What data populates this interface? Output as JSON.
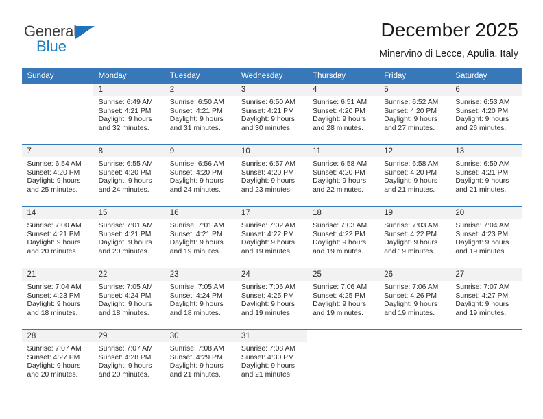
{
  "brand": {
    "name_top": "General",
    "name_bottom": "Blue",
    "triangle_icon": "blue-triangle-logo-mark",
    "color": "#1a7fc1"
  },
  "header": {
    "title": "December 2025",
    "subtitle": "Minervino di Lecce, Apulia, Italy"
  },
  "theme": {
    "header_bg": "#3878b8",
    "header_text": "#ffffff",
    "daynum_bg": "#f2f2f2",
    "grid_line": "#3878b8"
  },
  "calendar": {
    "weekday_headers": [
      "Sunday",
      "Monday",
      "Tuesday",
      "Wednesday",
      "Thursday",
      "Friday",
      "Saturday"
    ],
    "weeks": [
      [
        {
          "day": "",
          "info": ""
        },
        {
          "day": "1",
          "info": "Sunrise: 6:49 AM\nSunset: 4:21 PM\nDaylight: 9 hours\nand 32 minutes."
        },
        {
          "day": "2",
          "info": "Sunrise: 6:50 AM\nSunset: 4:21 PM\nDaylight: 9 hours\nand 31 minutes."
        },
        {
          "day": "3",
          "info": "Sunrise: 6:50 AM\nSunset: 4:21 PM\nDaylight: 9 hours\nand 30 minutes."
        },
        {
          "day": "4",
          "info": "Sunrise: 6:51 AM\nSunset: 4:20 PM\nDaylight: 9 hours\nand 28 minutes."
        },
        {
          "day": "5",
          "info": "Sunrise: 6:52 AM\nSunset: 4:20 PM\nDaylight: 9 hours\nand 27 minutes."
        },
        {
          "day": "6",
          "info": "Sunrise: 6:53 AM\nSunset: 4:20 PM\nDaylight: 9 hours\nand 26 minutes."
        }
      ],
      [
        {
          "day": "7",
          "info": "Sunrise: 6:54 AM\nSunset: 4:20 PM\nDaylight: 9 hours\nand 25 minutes."
        },
        {
          "day": "8",
          "info": "Sunrise: 6:55 AM\nSunset: 4:20 PM\nDaylight: 9 hours\nand 24 minutes."
        },
        {
          "day": "9",
          "info": "Sunrise: 6:56 AM\nSunset: 4:20 PM\nDaylight: 9 hours\nand 24 minutes."
        },
        {
          "day": "10",
          "info": "Sunrise: 6:57 AM\nSunset: 4:20 PM\nDaylight: 9 hours\nand 23 minutes."
        },
        {
          "day": "11",
          "info": "Sunrise: 6:58 AM\nSunset: 4:20 PM\nDaylight: 9 hours\nand 22 minutes."
        },
        {
          "day": "12",
          "info": "Sunrise: 6:58 AM\nSunset: 4:20 PM\nDaylight: 9 hours\nand 21 minutes."
        },
        {
          "day": "13",
          "info": "Sunrise: 6:59 AM\nSunset: 4:21 PM\nDaylight: 9 hours\nand 21 minutes."
        }
      ],
      [
        {
          "day": "14",
          "info": "Sunrise: 7:00 AM\nSunset: 4:21 PM\nDaylight: 9 hours\nand 20 minutes."
        },
        {
          "day": "15",
          "info": "Sunrise: 7:01 AM\nSunset: 4:21 PM\nDaylight: 9 hours\nand 20 minutes."
        },
        {
          "day": "16",
          "info": "Sunrise: 7:01 AM\nSunset: 4:21 PM\nDaylight: 9 hours\nand 19 minutes."
        },
        {
          "day": "17",
          "info": "Sunrise: 7:02 AM\nSunset: 4:22 PM\nDaylight: 9 hours\nand 19 minutes."
        },
        {
          "day": "18",
          "info": "Sunrise: 7:03 AM\nSunset: 4:22 PM\nDaylight: 9 hours\nand 19 minutes."
        },
        {
          "day": "19",
          "info": "Sunrise: 7:03 AM\nSunset: 4:22 PM\nDaylight: 9 hours\nand 19 minutes."
        },
        {
          "day": "20",
          "info": "Sunrise: 7:04 AM\nSunset: 4:23 PM\nDaylight: 9 hours\nand 19 minutes."
        }
      ],
      [
        {
          "day": "21",
          "info": "Sunrise: 7:04 AM\nSunset: 4:23 PM\nDaylight: 9 hours\nand 18 minutes."
        },
        {
          "day": "22",
          "info": "Sunrise: 7:05 AM\nSunset: 4:24 PM\nDaylight: 9 hours\nand 18 minutes."
        },
        {
          "day": "23",
          "info": "Sunrise: 7:05 AM\nSunset: 4:24 PM\nDaylight: 9 hours\nand 18 minutes."
        },
        {
          "day": "24",
          "info": "Sunrise: 7:06 AM\nSunset: 4:25 PM\nDaylight: 9 hours\nand 19 minutes."
        },
        {
          "day": "25",
          "info": "Sunrise: 7:06 AM\nSunset: 4:25 PM\nDaylight: 9 hours\nand 19 minutes."
        },
        {
          "day": "26",
          "info": "Sunrise: 7:06 AM\nSunset: 4:26 PM\nDaylight: 9 hours\nand 19 minutes."
        },
        {
          "day": "27",
          "info": "Sunrise: 7:07 AM\nSunset: 4:27 PM\nDaylight: 9 hours\nand 19 minutes."
        }
      ],
      [
        {
          "day": "28",
          "info": "Sunrise: 7:07 AM\nSunset: 4:27 PM\nDaylight: 9 hours\nand 20 minutes."
        },
        {
          "day": "29",
          "info": "Sunrise: 7:07 AM\nSunset: 4:28 PM\nDaylight: 9 hours\nand 20 minutes."
        },
        {
          "day": "30",
          "info": "Sunrise: 7:08 AM\nSunset: 4:29 PM\nDaylight: 9 hours\nand 21 minutes."
        },
        {
          "day": "31",
          "info": "Sunrise: 7:08 AM\nSunset: 4:30 PM\nDaylight: 9 hours\nand 21 minutes."
        },
        {
          "day": "",
          "info": ""
        },
        {
          "day": "",
          "info": ""
        },
        {
          "day": "",
          "info": ""
        }
      ]
    ]
  }
}
